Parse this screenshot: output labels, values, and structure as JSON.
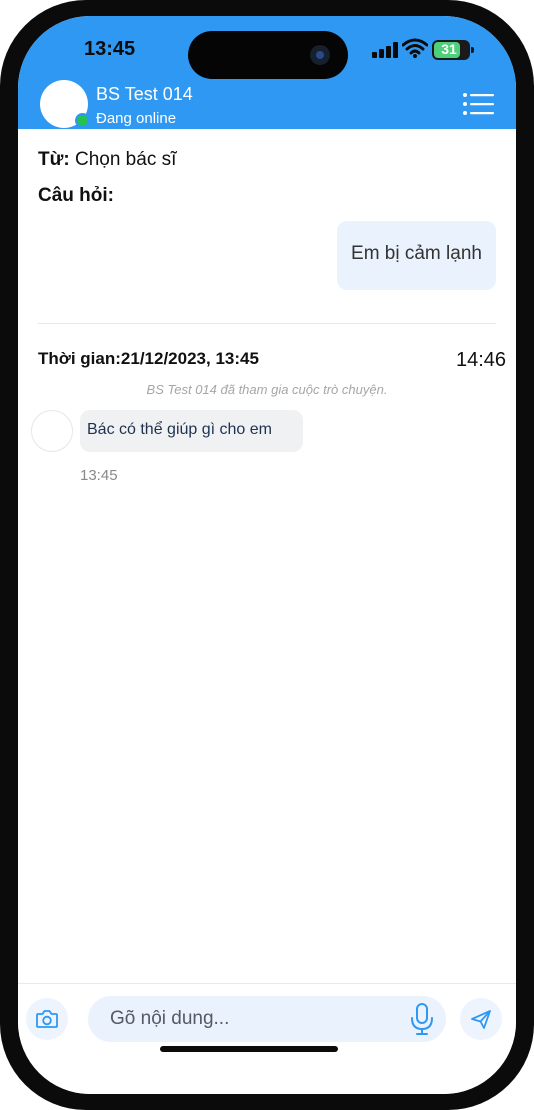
{
  "status_bar": {
    "time": "13:45",
    "battery": "31"
  },
  "header": {
    "doctor_name": "BS Test 014",
    "status": "Đang online"
  },
  "question_block": {
    "from_label": "Từ:",
    "from_value": " Chọn bác sĩ",
    "question_label": "Câu hỏi:",
    "question_text": "Em bị cảm lạnh"
  },
  "conversation": {
    "time_label": "Thời gian:21/12/2023, 13:45",
    "current_time": "14:46",
    "system_message": "BS Test 014 đã tham gia cuộc trò chuyện.",
    "messages": [
      {
        "text": "Bác có thể giúp gì cho em",
        "time": "13:45"
      }
    ]
  },
  "composer": {
    "placeholder": "Gõ nội dung..."
  },
  "colors": {
    "header_bg": "#2f98f2",
    "online": "#23c251",
    "bubble_out": "#e9f2fd",
    "bubble_in": "#f0f1f3"
  },
  "icons": [
    "camera-icon",
    "microphone-icon",
    "send-icon",
    "menu-list-icon",
    "signal-icon",
    "wifi-icon",
    "battery-icon"
  ]
}
